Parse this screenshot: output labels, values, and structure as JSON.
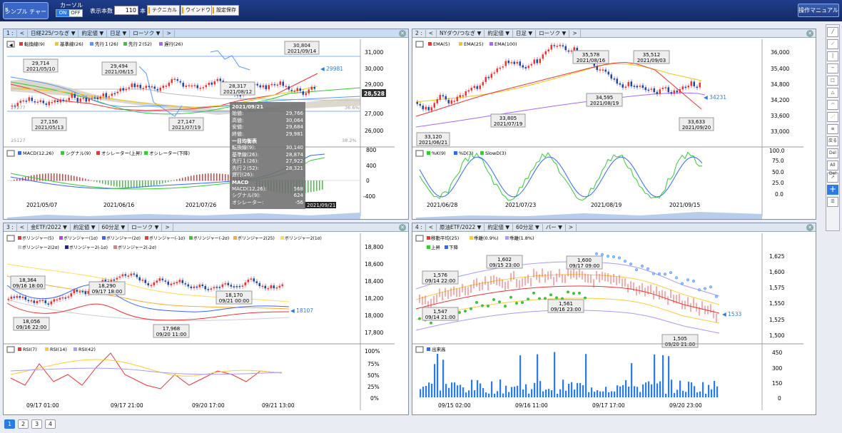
{
  "header": {
    "logo": "シンプル チャート",
    "logo_s": "S",
    "cursor_label": "カーソル",
    "cursor_on": "ON",
    "cursor_off": "OFF",
    "count_label": "表示本数",
    "count_value": "110",
    "count_unit": "本",
    "btn_technical": "テクニカル",
    "btn_window": "ウインドウ",
    "btn_save": "設定保存",
    "btn_manual": "操作マニュアル"
  },
  "panels": [
    {
      "num": "1 :",
      "symbol": "日経225/つなぎ ▼",
      "price": "約定値 ▼",
      "period": "日足 ▼",
      "style": "ローソク ▼",
      "legend1": [
        "転換線(9)",
        "基準線(26)",
        "先行１(26)",
        "先行２(52)",
        "遅行(26)"
      ],
      "legend2": [
        "MACD(12,26)",
        "シグナル(9)",
        "オシレーター(上昇)",
        "オシレーター(下降)"
      ],
      "yticks": [
        "31,000",
        "30,000",
        "29,000",
        "28,000",
        "27,000",
        "26,000"
      ],
      "y2ticks": [
        "800",
        "400",
        "0",
        "-400"
      ],
      "xticks": [
        "2021/05/07",
        "2021/06/16",
        "2021/07/26"
      ],
      "last": "28,528",
      "arrow": "◀ 29981",
      "ann": [
        [
          "29,714",
          "2021/05/10"
        ],
        [
          "27,156",
          "2021/05/13"
        ],
        [
          "29,494",
          "2021/06/15"
        ],
        [
          "27,147",
          "2021/07/19"
        ],
        [
          "28,317",
          "2021/08/12"
        ],
        [
          "30,804",
          "2021/09/14"
        ]
      ],
      "pct_l": "27277",
      "pct_r": "36.6%",
      "pct_l2": "25127",
      "pct_r2": "38.2%"
    },
    {
      "num": "2 :",
      "symbol": "NYダウ/つなぎ ▼",
      "price": "約定値 ▼",
      "period": "日足 ▼",
      "style": "ローソク ▼",
      "legend1": [
        "EMA(5)",
        "EMA(25)",
        "EMA(100)"
      ],
      "legend2": [
        "%K(9)",
        "%D(3)",
        "SlowD(3)"
      ],
      "yticks": [
        "36,000",
        "35,400",
        "34,800",
        "34,200",
        "33,600",
        "33,000"
      ],
      "y2ticks": [
        "100.0",
        "75.0",
        "50.0",
        "25.0",
        "0.0"
      ],
      "xticks": [
        "2021/06/28",
        "2021/07/23",
        "2021/08/19",
        "2021/09/15"
      ],
      "arrow": "◀ 34231",
      "ann": [
        [
          "33,120",
          "2021/06/21"
        ],
        [
          "33,805",
          "2021/07/19"
        ],
        [
          "35,578",
          "2021/08/16"
        ],
        [
          "34,595",
          "2021/08/19"
        ],
        [
          "35,512",
          "2021/09/03"
        ],
        [
          "33,633",
          "2021/09/20"
        ]
      ]
    },
    {
      "num": "3 :",
      "symbol": "金ETF/2022 ▼",
      "price": "約定値 ▼",
      "period": "60分足 ▼",
      "style": "ローソク ▼",
      "legend1": [
        "ボリンジャー(5)",
        "ボリンジャー(1σ)",
        "ボリンジャー(2σ)",
        "ボリンジャー(-1σ)",
        "ボリンジャー(-2σ)",
        "ボリンジャー2(25)",
        "ボリンジャー2(1σ)"
      ],
      "legend1b": [
        "ボリンジャー2(2σ)",
        "ボリンジャー2(-1σ)",
        "ボリンジャー2(-2σ)"
      ],
      "legend2": [
        "RSI(7)",
        "RSI(14)",
        "RSI(42)"
      ],
      "yticks": [
        "18,800",
        "18,600",
        "18,400",
        "18,200",
        "18,000",
        "17,800"
      ],
      "y2ticks": [
        "100%",
        "75%",
        "50%",
        "25%",
        "0%"
      ],
      "xticks": [
        "09/17 01:00",
        "09/17 21:00",
        "09/20 17:00",
        "09/21 13:00"
      ],
      "arrow": "◀ 18107",
      "ann": [
        [
          "18,364",
          "09/16 18:00"
        ],
        [
          "18,056",
          "09/16 22:00"
        ],
        [
          "18,290",
          "09/17 18:00"
        ],
        [
          "17,968",
          "09/20 11:00"
        ],
        [
          "18,170",
          "09/21 00:00"
        ]
      ]
    },
    {
      "num": "4 :",
      "symbol": "原油ETF/2022 ▼",
      "price": "約定値 ▼",
      "period": "60分足 ▼",
      "style": "バー ▼",
      "legend1": [
        "移動平均(25)",
        "乖離(0.9%)",
        "乖離(1.8%)"
      ],
      "legend1b": [
        "上昇",
        "下降"
      ],
      "legend2": [
        "出来高"
      ],
      "yticks": [
        "1,625",
        "1,600",
        "1,575",
        "1,550",
        "1,525",
        "1,500"
      ],
      "y2ticks": [
        "450",
        "300",
        "150",
        "0"
      ],
      "xticks": [
        "09/15 02:00",
        "09/16 11:00",
        "09/17 17:00",
        "09/20 23:00"
      ],
      "arrow": "◀ 1533",
      "ann": [
        [
          "1,576",
          "09/14 22:00"
        ],
        [
          "1,547",
          "09/14 21:00"
        ],
        [
          "1,602",
          "09/15 23:00"
        ],
        [
          "1,600",
          "09/17 09:00"
        ],
        [
          "1,561",
          "09/16 23:00"
        ],
        [
          "1,505",
          "09/20 21:00"
        ]
      ]
    }
  ],
  "tooltip": {
    "date": "2021/09/21",
    "rows": [
      [
        "始値:",
        "29,766"
      ],
      [
        "高値:",
        "30,064"
      ],
      [
        "安値:",
        "29,684"
      ],
      [
        "終値:",
        "29,981"
      ]
    ],
    "sec1": "一目均衡表",
    "rows2": [
      [
        "転換線(9):",
        "30,140"
      ],
      [
        "基準線(26):",
        "28,874"
      ],
      [
        "先行１(26):",
        "27,922"
      ],
      [
        "先行２(52):",
        "28,321"
      ],
      [
        "遅行(26):",
        ""
      ]
    ],
    "sec2": "MACD",
    "rows3": [
      [
        "MACD(12,26):",
        "568"
      ],
      [
        "シグナル(9):",
        "624"
      ],
      [
        "オシレーター:",
        "-56"
      ]
    ],
    "date2": "2021/09/21"
  },
  "sidebar": [
    "戻る",
    "Del",
    "All Del"
  ],
  "pages": [
    "1",
    "2",
    "3",
    "4"
  ]
}
